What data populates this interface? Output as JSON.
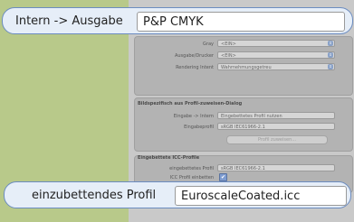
{
  "callout_top": {
    "label": "Intern -> Ausgabe",
    "value": "P&P CMYK"
  },
  "callout_bottom": {
    "label": "einzubettendes Profil",
    "value": "EuroscaleCoated.icc"
  },
  "settings": {
    "gray_label": "Gray",
    "gray_value": "<EIN>",
    "output_label": "Ausgabe/Drucker",
    "output_value": "<EIN>",
    "intent_label": "Rendering Intent",
    "intent_value": "Wahrnehmungsgetreu"
  },
  "assign_section": {
    "title": "Bildspezifisch aus Profil-zuweisen-Dialog",
    "input_label": "Eingabe -> Intern",
    "input_value": "Eingebettetes Profil nutzen",
    "profile_label": "Eingabeprofil",
    "profile_value": "sRGB IEC61966-2.1",
    "assign_button": "Profil zuweisen..."
  },
  "embedded_section": {
    "title": "Eingebettete ICC-Profile",
    "embedded_label": "eingebettetes Profil",
    "embedded_value": "sRGB IEC61966-2.1",
    "embed_check_label": "ICC Profil einbetten",
    "embed_checked": true,
    "to_embed_label": "einzubettendes Profil",
    "to_embed_value": "EuroscaleCoated.icc"
  }
}
